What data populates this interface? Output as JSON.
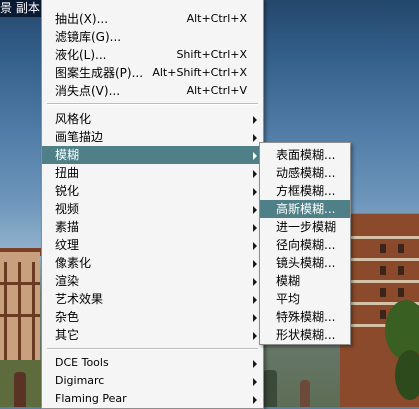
{
  "window": {
    "title": "景 副本"
  },
  "main_menu": {
    "group1": [
      {
        "label": "抽出(X)...",
        "shortcut": "Alt+Ctrl+X"
      },
      {
        "label": "滤镜库(G)...",
        "shortcut": ""
      },
      {
        "label": "液化(L)...",
        "shortcut": "Shift+Ctrl+X"
      },
      {
        "label": "图案生成器(P)...",
        "shortcut": "Alt+Shift+Ctrl+X"
      },
      {
        "label": "消失点(V)...",
        "shortcut": "Alt+Ctrl+V"
      }
    ],
    "group2": [
      {
        "label": "风格化",
        "highlight": false
      },
      {
        "label": "画笔描边",
        "highlight": false
      },
      {
        "label": "模糊",
        "highlight": true
      },
      {
        "label": "扭曲",
        "highlight": false
      },
      {
        "label": "锐化",
        "highlight": false
      },
      {
        "label": "视频",
        "highlight": false
      },
      {
        "label": "素描",
        "highlight": false
      },
      {
        "label": "纹理",
        "highlight": false
      },
      {
        "label": "像素化",
        "highlight": false
      },
      {
        "label": "渲染",
        "highlight": false
      },
      {
        "label": "艺术效果",
        "highlight": false
      },
      {
        "label": "杂色",
        "highlight": false
      },
      {
        "label": "其它",
        "highlight": false
      }
    ],
    "group3": [
      {
        "label": "DCE Tools"
      },
      {
        "label": "Digimarc"
      },
      {
        "label": "Flaming Pear"
      }
    ]
  },
  "blur_submenu": [
    {
      "label": "表面模糊...",
      "highlight": false
    },
    {
      "label": "动感模糊...",
      "highlight": false
    },
    {
      "label": "方框模糊...",
      "highlight": false
    },
    {
      "label": "高斯模糊...",
      "highlight": true
    },
    {
      "label": "进一步模糊",
      "highlight": false
    },
    {
      "label": "径向模糊...",
      "highlight": false
    },
    {
      "label": "镜头模糊...",
      "highlight": false
    },
    {
      "label": "模糊",
      "highlight": false
    },
    {
      "label": "平均",
      "highlight": false
    },
    {
      "label": "特殊模糊...",
      "highlight": false
    },
    {
      "label": "形状模糊...",
      "highlight": false
    }
  ]
}
